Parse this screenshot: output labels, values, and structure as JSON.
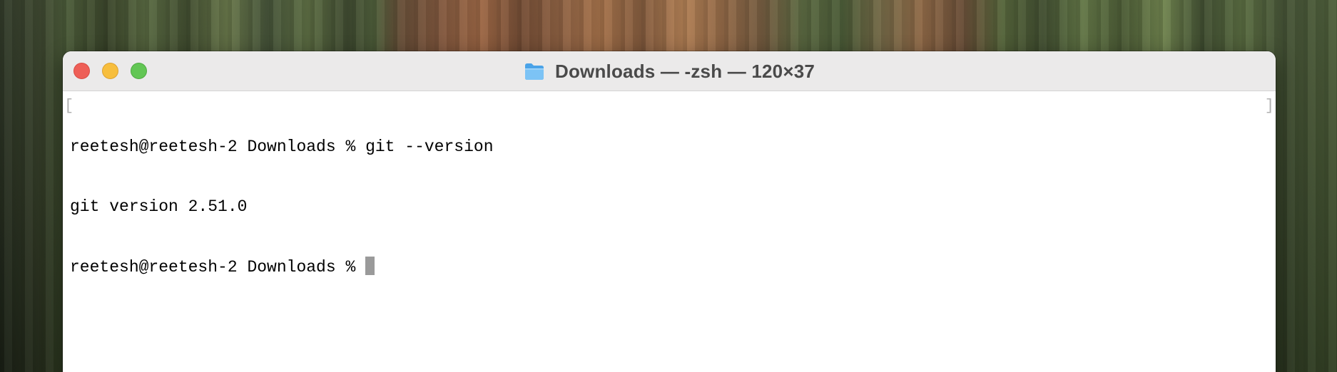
{
  "window": {
    "title": "Downloads — -zsh — 120×37",
    "title_icon": "folder-icon"
  },
  "traffic_lights": {
    "close_color": "#ee5f57",
    "minimize_color": "#f7be3d",
    "maximize_color": "#62c654"
  },
  "terminal": {
    "lines": [
      "reetesh@reetesh-2 Downloads % git --version",
      "git version 2.51.0",
      "reetesh@reetesh-2 Downloads % "
    ],
    "cursor_color": "#9a9a9a"
  }
}
